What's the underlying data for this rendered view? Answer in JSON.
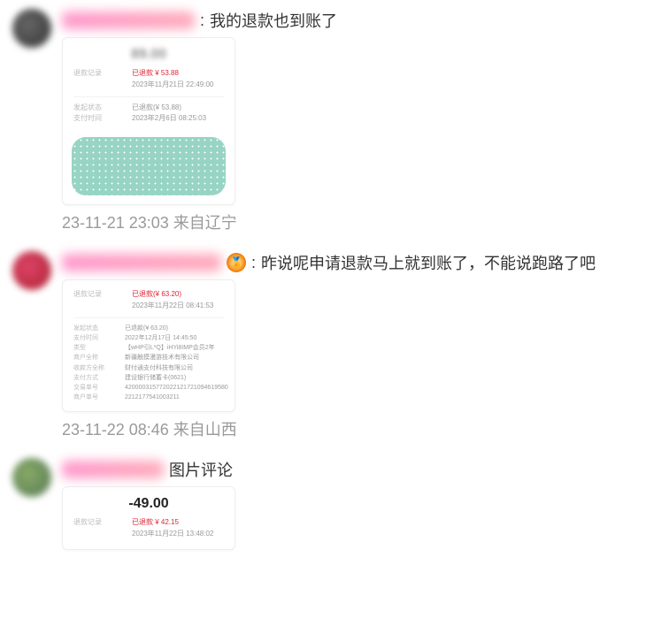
{
  "comments": [
    {
      "text": "我的退款也到账了",
      "meta_time": "23-11-21 23:03",
      "meta_from": "来自辽宁",
      "shot": {
        "rec_label": "退款记录",
        "rec_status": "已退款 ¥ 53.88",
        "rec_time": "2023年11月21日 22:49:00",
        "pay_status_label": "发起状态",
        "pay_status": "已退款(¥ 53.88)",
        "pay_time_label": "支付时间",
        "pay_time": "2023年2月6日 08:25:03"
      }
    },
    {
      "text": "昨说呢申请退款马上就到账了，不能说跑路了吧",
      "meta_time": "23-11-22 08:46",
      "meta_from": "来自山西",
      "shot": {
        "rec_label": "退款记录",
        "rec_status": "已退款(¥ 63.20)",
        "rec_time": "2023年11月22日 08:41:53",
        "rows": [
          {
            "l": "发起状态",
            "v": "已退款(¥ 63.20)"
          },
          {
            "l": "支付时间",
            "v": "2022年12月17日 14:45:50"
          },
          {
            "l": "类型",
            "v": "【wHP引L*Q】iHYi8IMP会员2年"
          },
          {
            "l": "商户全称",
            "v": "新疆触摸漫游技术有限公司"
          },
          {
            "l": "收款方全称",
            "v": "财付通支付科技有限公司"
          },
          {
            "l": "支付方式",
            "v": "建设银行储蓄卡(0621)"
          },
          {
            "l": "交易单号",
            "v": "420000315772022121721094619580"
          },
          {
            "l": "商户单号",
            "v": "2212177541003211"
          }
        ]
      }
    },
    {
      "text": "图片评论",
      "meta_time": "",
      "meta_from": "",
      "shot": {
        "price": "-49.00",
        "rec_label": "退款记录",
        "rec_status": "已退款 ¥ 42.15",
        "rec_time": "2023年11月22日 13:48:02"
      }
    }
  ]
}
